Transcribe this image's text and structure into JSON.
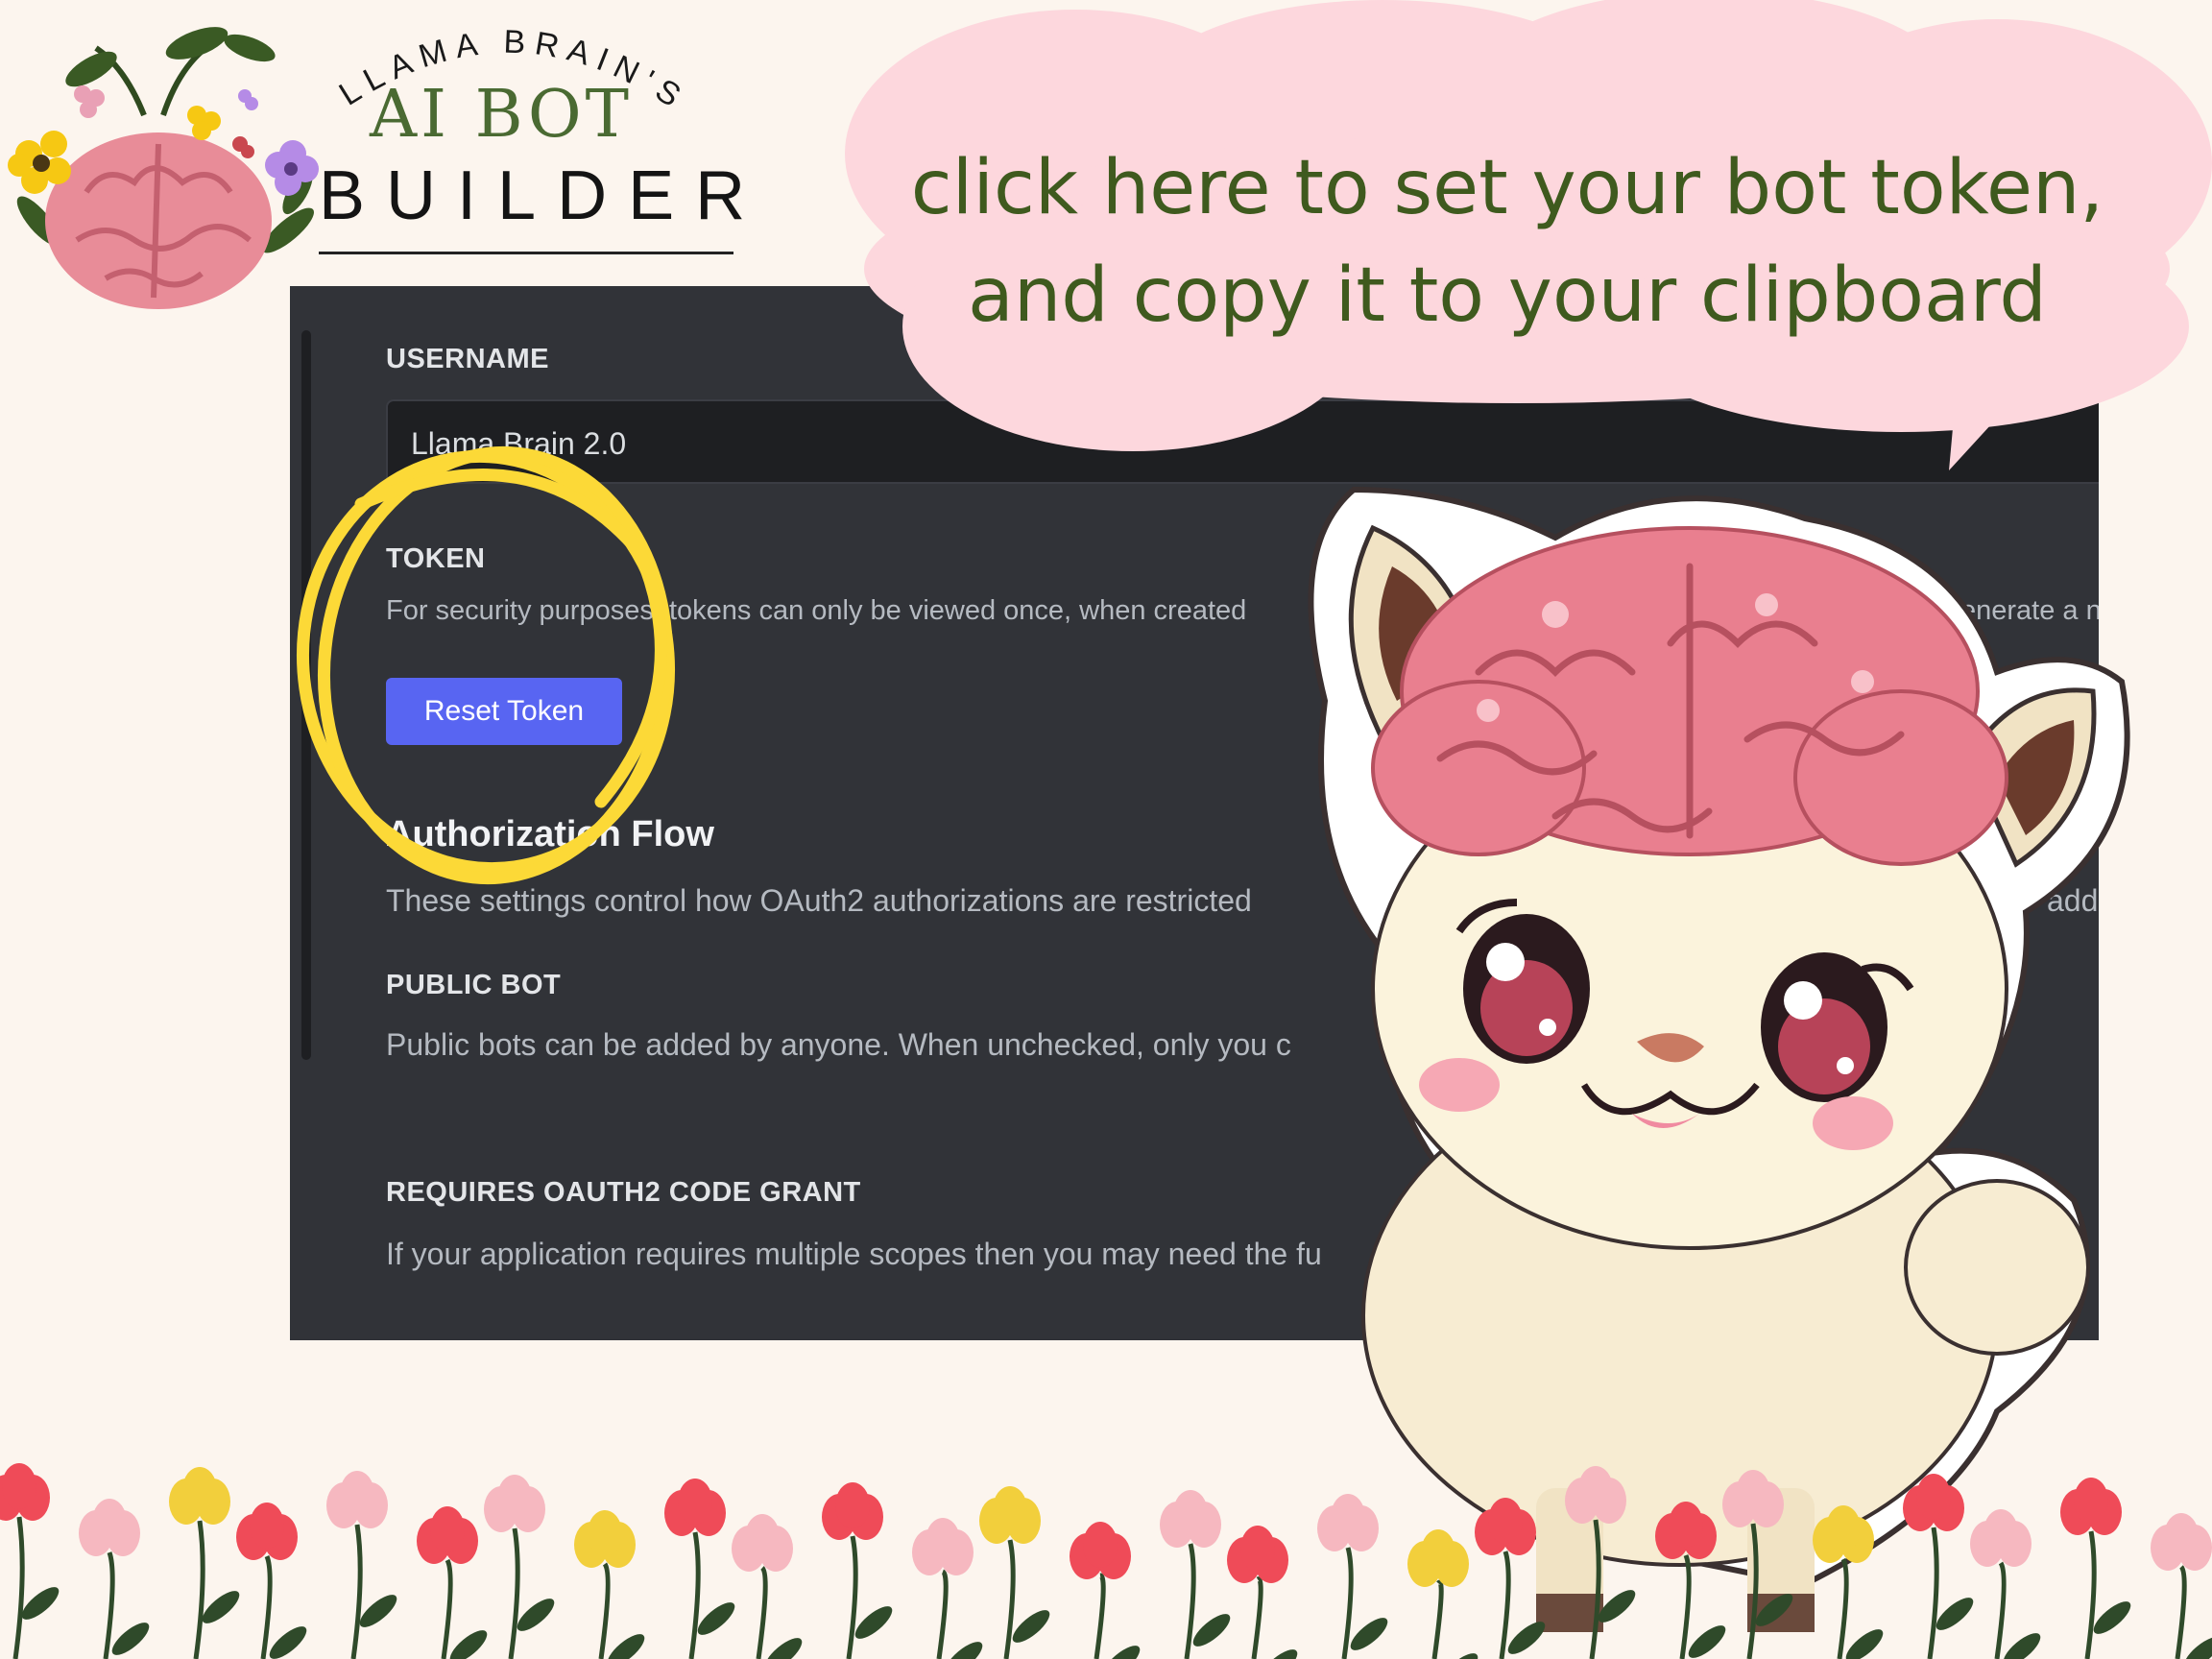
{
  "logo": {
    "arc_text": "LLAMA BRAIN'S",
    "line1": "AI BOT",
    "line2": "BUILDER"
  },
  "callout": {
    "line1": "click here to set your bot token,",
    "line2": "and copy it to your clipboard"
  },
  "panel": {
    "username_label": "USERNAME",
    "username_value": "Llama Brain 2.0",
    "token_label": "TOKEN",
    "token_desc": "For security purposes, tokens can only be viewed once, when created",
    "token_desc_tail": "enerate a ne",
    "reset_button": "Reset Token",
    "auth_heading": "Authorization Flow",
    "auth_desc": "These settings control how OAuth2 authorizations are restricted",
    "auth_desc_tail": "add",
    "public_bot_label": "PUBLIC BOT",
    "public_bot_desc": "Public bots can be added by anyone. When unchecked, only you c",
    "code_grant_label": "REQUIRES OAUTH2 CODE GRANT",
    "code_grant_desc": "If your application requires multiple scopes then you may need the fu"
  },
  "colors": {
    "background": "#fcf5ee",
    "panel": "#313338",
    "accent_button": "#5865f2",
    "highlight_circle": "#fcd937",
    "bubble": "#fdd7dd",
    "bubble_text": "#3f5a1e"
  }
}
